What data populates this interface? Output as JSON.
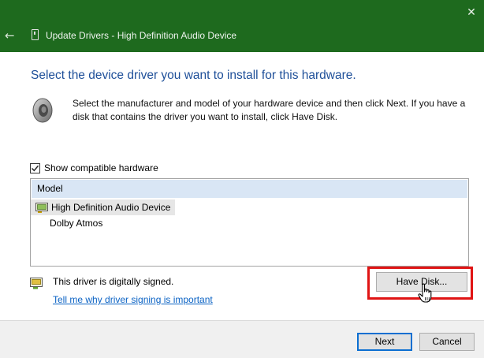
{
  "window": {
    "title": "Update Drivers - High Definition Audio Device",
    "close_glyph": "✕",
    "back_glyph": "←"
  },
  "main": {
    "heading": "Select the device driver you want to install for this hardware.",
    "description": "Select the manufacturer and model of your hardware device and then click Next. If you have a disk that contains the driver you want to install, click Have Disk.",
    "show_compatible_label": "Show compatible hardware",
    "show_compatible_checked": true,
    "model_list": {
      "header": "Model",
      "items": [
        {
          "label": "High Definition Audio Device",
          "selected": true
        },
        {
          "label": "Dolby Atmos",
          "selected": false
        }
      ]
    },
    "signed_text": "This driver is digitally signed.",
    "signing_link": "Tell me why driver signing is important",
    "have_disk_label": "Have Disk..."
  },
  "footer": {
    "next_label": "Next",
    "cancel_label": "Cancel"
  },
  "colors": {
    "titlebar": "#1e6a1e",
    "heading": "#1e4f99",
    "link": "#0a62c4",
    "highlight": "#e01414",
    "default_button_border": "#0c6fd1"
  }
}
